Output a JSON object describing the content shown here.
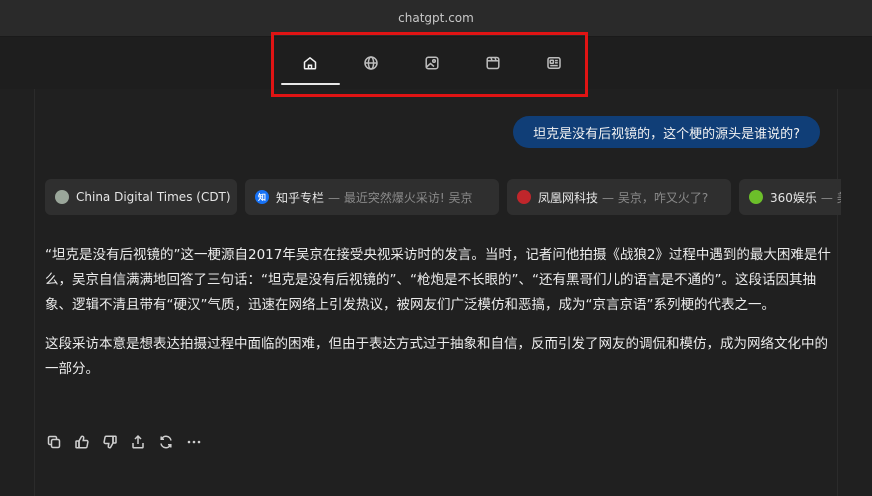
{
  "browser": {
    "url": "chatgpt.com"
  },
  "tabs": [
    {
      "icon": "home-icon",
      "active": true
    },
    {
      "icon": "globe-icon",
      "active": false
    },
    {
      "icon": "image-icon",
      "active": false
    },
    {
      "icon": "video-icon",
      "active": false
    },
    {
      "icon": "news-icon",
      "active": false
    }
  ],
  "user_message": "坦克是没有后视镜的，这个梗的源头是谁说的?",
  "sources": [
    {
      "name": "China Digital Times (CDT)",
      "snippet": "",
      "favicon_color": "#9aa69a",
      "favicon_glyph": ""
    },
    {
      "name": "知乎专栏",
      "snippet": "— 最近突然爆火采访! 吴京",
      "favicon_color": "#1772f6",
      "favicon_glyph": "知"
    },
    {
      "name": "凤凰网科技",
      "snippet": "— 吴京，咋又火了?",
      "favicon_color": "#c0262b",
      "favicon_glyph": ""
    },
    {
      "name": "360娱乐",
      "snippet": "— 美",
      "favicon_color": "#6cbf2a",
      "favicon_glyph": ""
    }
  ],
  "answer": {
    "p1": "“坦克是没有后视镜的”这一梗源自2017年吴京在接受央视采访时的发言。当时，记者问他拍摄《战狼2》过程中遇到的最大困难是什么，吴京自信满满地回答了三句话：“坦克是没有后视镜的”、“枪炮是不长眼的”、“还有黑哥们儿的语言是不通的”。这段话因其抽象、逻辑不清且带有“硬汉”气质，迅速在网络上引发热议，被网友们广泛模仿和恶搞，成为“京言京语”系列梗的代表之一。",
    "p2": "这段采访本意是想表达拍摄过程中面临的困难，但由于表达方式过于抽象和自信，反而引发了网友的调侃和模仿，成为网络文化中的一部分。"
  },
  "actions": [
    "copy-icon",
    "thumbs-up-icon",
    "thumbs-down-icon",
    "share-icon",
    "regenerate-icon",
    "more-icon"
  ],
  "colors": {
    "highlight": "#e01414",
    "user_bubble": "#103e77",
    "background": "#202020"
  }
}
